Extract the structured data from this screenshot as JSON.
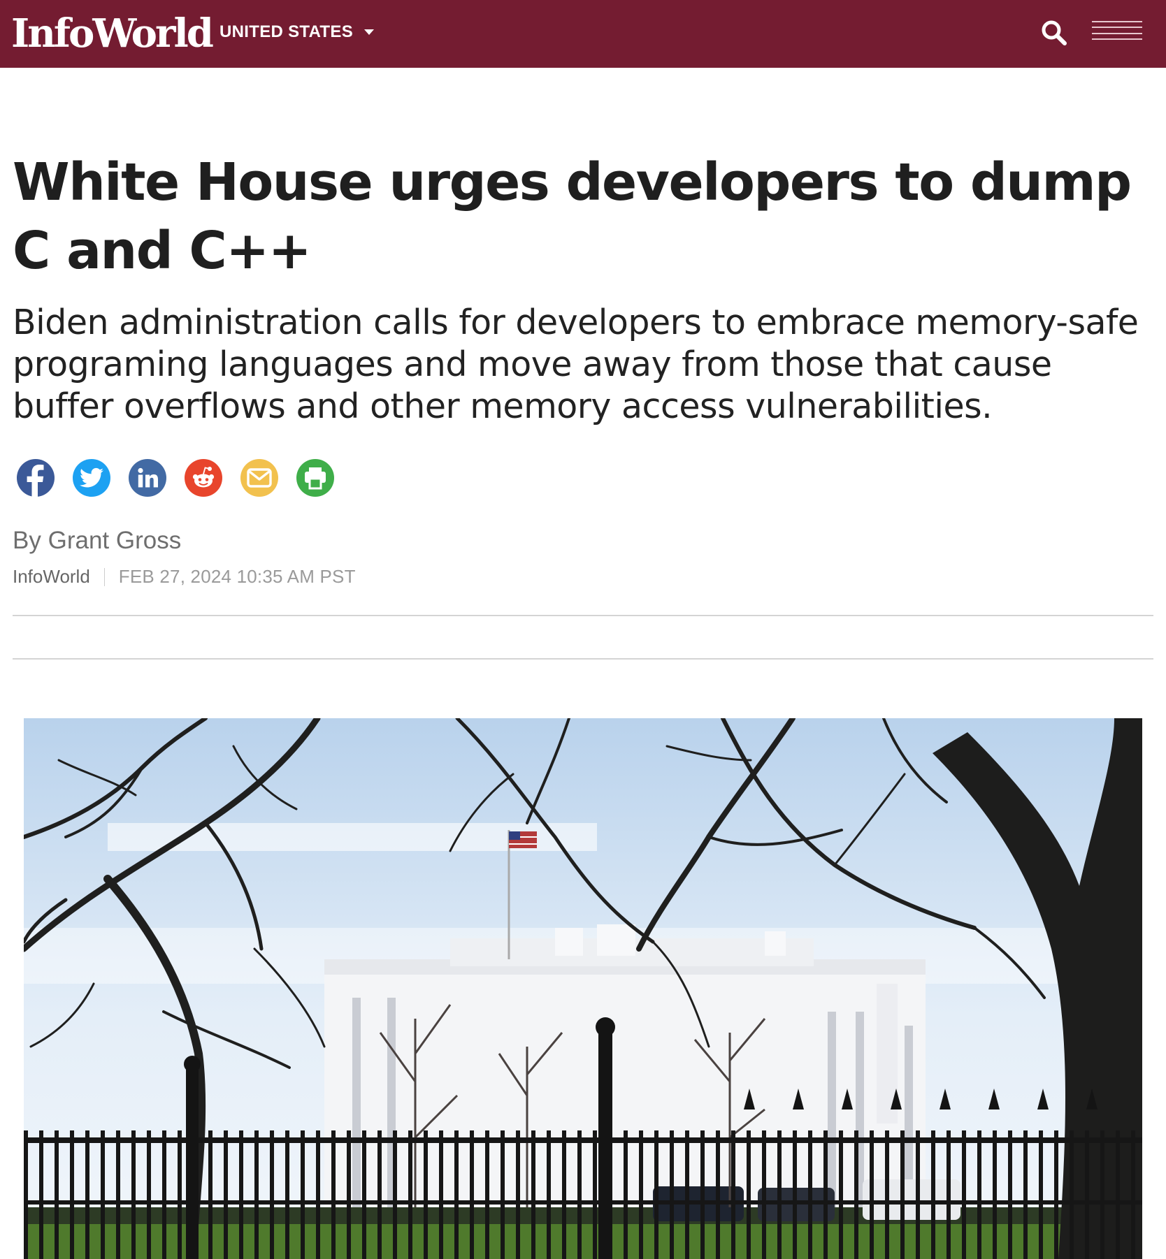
{
  "header": {
    "logo_text": "InfoWorld",
    "region_label": "UNITED STATES",
    "icons": {
      "search": "search-icon",
      "menu": "hamburger-menu-icon",
      "region_dropdown": "caret-down-icon"
    },
    "colors": {
      "bar_background": "#741c31",
      "text": "#ffffff"
    }
  },
  "article": {
    "headline": "White House urges developers to dump C and C++",
    "dek": "Biden administration calls for developers to embrace memory-safe programing languages and move away from those that cause buffer overflows and other memory access vulnerabilities.",
    "byline_prefix": "By",
    "author": "Grant Gross",
    "publication": "InfoWorld",
    "date": "FEB 27, 2024 10:35 AM PST"
  },
  "share": {
    "buttons": [
      {
        "network": "facebook",
        "icon": "facebook-icon",
        "color": "#3b5998"
      },
      {
        "network": "twitter",
        "icon": "twitter-icon",
        "color": "#1da1f2"
      },
      {
        "network": "linkedin",
        "icon": "linkedin-icon",
        "color": "#426aa4"
      },
      {
        "network": "reddit",
        "icon": "reddit-icon",
        "color": "#e8452c"
      },
      {
        "network": "email",
        "icon": "email-icon",
        "color": "#f2c14e"
      },
      {
        "network": "print",
        "icon": "print-icon",
        "color": "#3fae49"
      }
    ]
  },
  "hero_image": {
    "subject": "White House behind a black iron fence with bare trees"
  }
}
